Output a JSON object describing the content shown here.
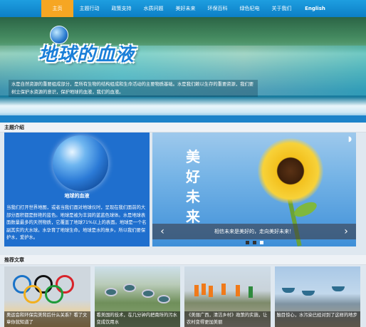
{
  "nav": {
    "items": [
      "主页",
      "主题行动",
      "政策支持",
      "水质问题",
      "美好未来",
      "环保百科",
      "绿色杞电",
      "关于我们",
      "English"
    ],
    "active_index": 0,
    "colors": {
      "bar": "#1e9ee0",
      "active": "#f6a623"
    }
  },
  "hero": {
    "title": "地球的血液",
    "description": "水是自然资源的重要组成部分，是所有生物的结构组成和生命活动的主要物质基础。水是我们赖以生存的重要资源，我们要树立保护水资源的意识，保护地球的血液，我们的血液。",
    "globe_icon": "globe-icon"
  },
  "sections": {
    "intro_title": "主题介绍",
    "articles_title": "推荐文章"
  },
  "intro": {
    "image_label": "地球的血液",
    "text": "当我们打开世界地图，或者当我们面对地球仪时，呈现在我们面前的大部分面积都是鲜艳的蓝色。地球是被为丰润的蓝蓝色球体。水是地球表面数量最多的天然物质，它覆盖了地球71%以上的表面。地球是一个名副其实的大水球。水孕育了地球生命。地球是水的故乡。所以我们要保护水，爱护水。"
  },
  "slider": {
    "vertical_text": [
      "美",
      "好",
      "未",
      "来"
    ],
    "caption": "相信未来是美好的，走向美好未来！",
    "prev_icon": "chevron-left-icon",
    "next_icon": "chevron-right-icon",
    "dots": 3,
    "active_dot": 2
  },
  "articles": [
    {
      "caption": "奥运会和环保完美背后什么关系？看了文章你就知道了",
      "image": "olympic-rings"
    },
    {
      "caption": "看美国的技术，在几分钟内把南所的污水变成饮用水",
      "image": "water-treatment-plant"
    },
    {
      "caption": "《美丽广西，清洁乡村》政策的实施，让农村变得更加美丽",
      "image": "sanitation-workers"
    },
    {
      "caption": "触目惊心，水污染已经对到了这样的地步",
      "image": "polluted-shore"
    }
  ]
}
